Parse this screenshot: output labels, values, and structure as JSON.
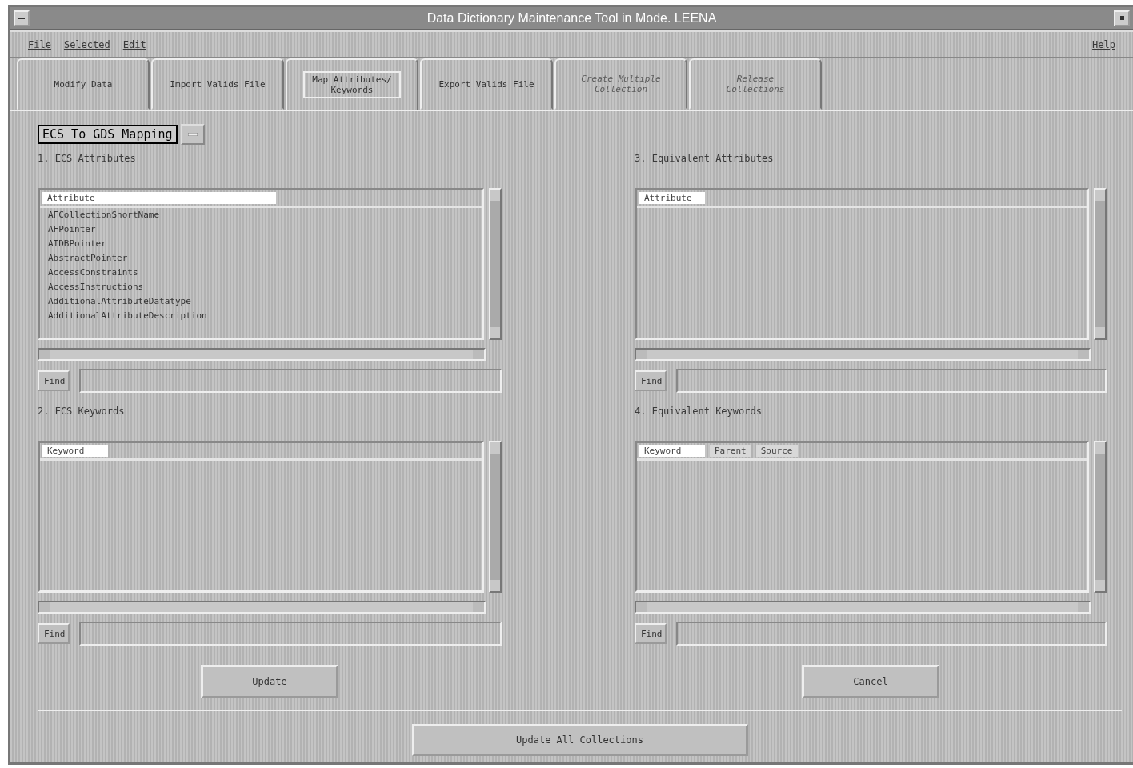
{
  "window": {
    "title": "Data Dictionary Maintenance Tool in Mode. LEENA"
  },
  "menu": [
    {
      "label": "File"
    },
    {
      "label": "Selected"
    },
    {
      "label": "Edit"
    }
  ],
  "help_menu": {
    "label": "Help"
  },
  "tabs": [
    {
      "label": "Modify Data",
      "selected": false,
      "disabled": false
    },
    {
      "label": "Import Valids File",
      "selected": false,
      "disabled": false
    },
    {
      "label": "Map Attributes/ Keywords",
      "selected": true,
      "disabled": false
    },
    {
      "label": "Export Valids File",
      "selected": false,
      "disabled": false
    },
    {
      "label": "Create Multiple Collection",
      "selected": false,
      "disabled": true
    },
    {
      "label": "Release Collections",
      "selected": false,
      "disabled": true
    }
  ],
  "mapping_option": {
    "value": "ECS To GDS Mapping"
  },
  "panels": [
    {
      "label": "1. ECS Attributes",
      "columns": [
        "Attribute"
      ],
      "rows": [
        "AFCollectionShortName",
        "AFPointer",
        "AIDBPointer",
        "AbstractPointer",
        "AccessConstraints",
        "AccessInstructions",
        "AdditionalAttributeDatatype",
        "AdditionalAttributeDescription"
      ],
      "find_button": "Find"
    },
    {
      "label": "3. Equivalent Attributes",
      "columns": [
        "Attribute"
      ],
      "find_button": "Find"
    },
    {
      "label": "2. ECS Keywords",
      "columns": [
        "Keyword"
      ],
      "find_button": "Find"
    },
    {
      "label": "4. Equivalent Keywords",
      "columns": [
        "Keyword",
        "Parent",
        "Source"
      ],
      "find_button": "Find"
    }
  ],
  "actions": [
    {
      "label": "Update"
    },
    {
      "label": "Cancel"
    }
  ],
  "footer_button": {
    "label": "Update All Collections"
  }
}
